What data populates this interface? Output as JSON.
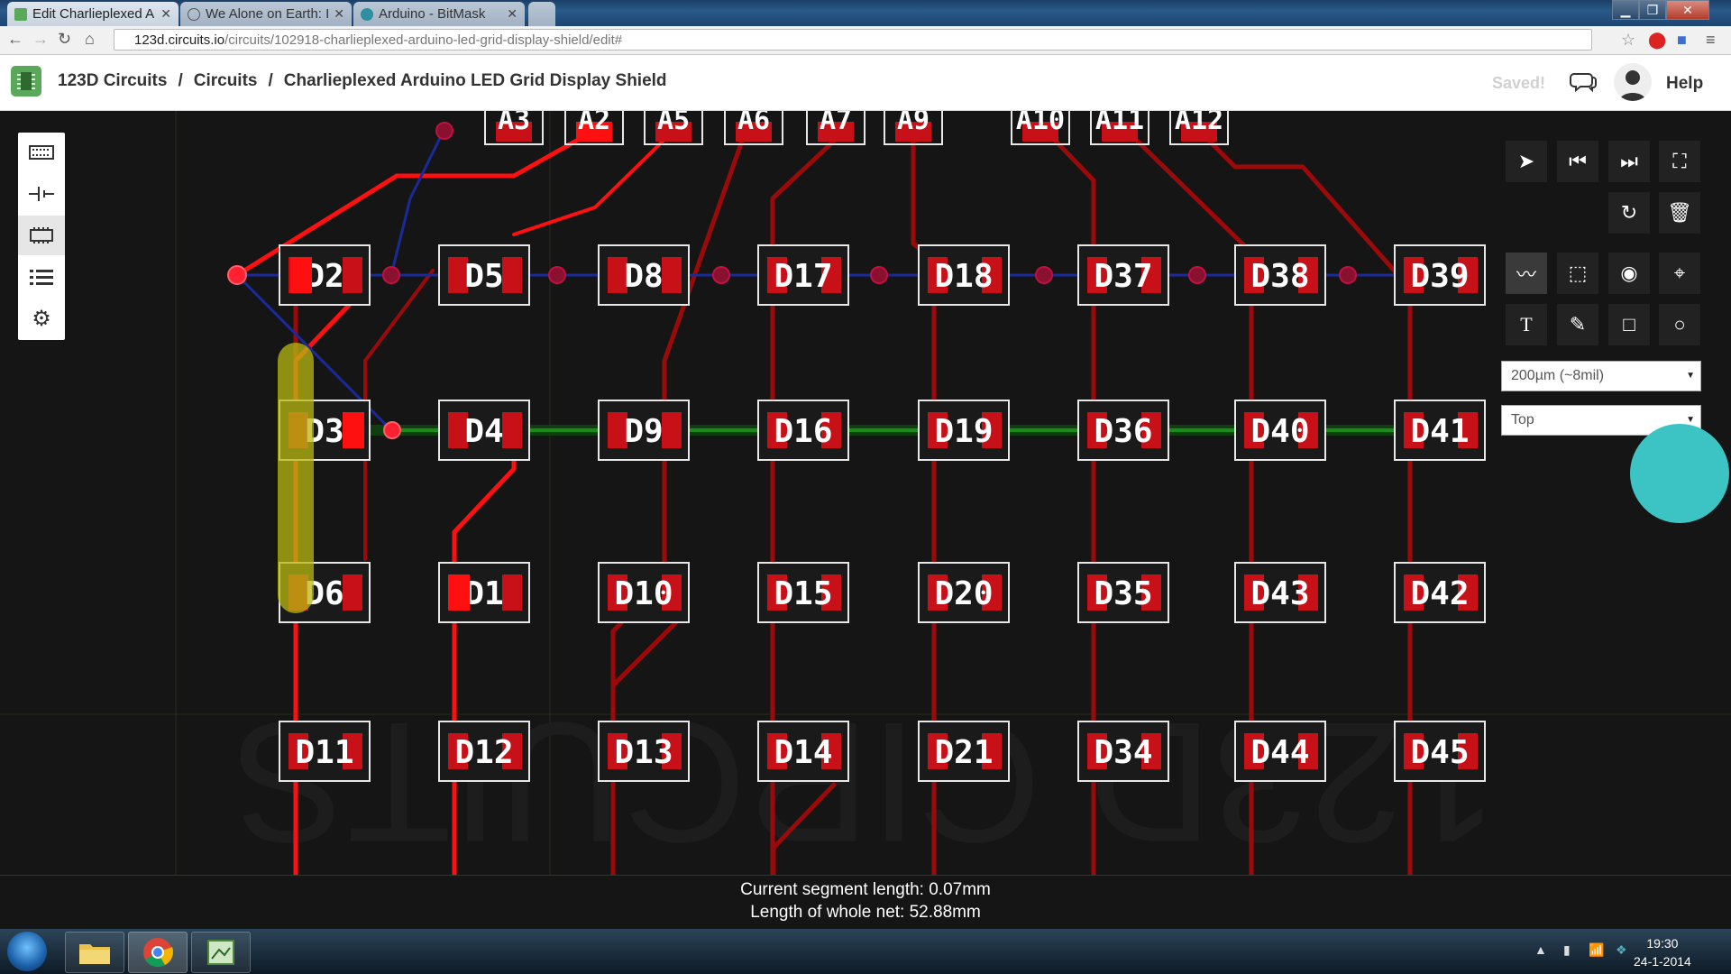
{
  "browser": {
    "tabs": [
      {
        "title": "Edit Charlieplexed A",
        "active": true
      },
      {
        "title": "We Alone on Earth: I",
        "active": false
      },
      {
        "title": "Arduino - BitMask",
        "active": false
      }
    ],
    "url_host": "123d.circuits.io",
    "url_path": "/circuits/102918-charlieplexed-arduino-led-grid-display-shield/edit#"
  },
  "header": {
    "crumbs": [
      "123D Circuits",
      "Circuits",
      "Charlieplexed Arduino LED Grid Display Shield"
    ],
    "separator": "/",
    "status": "Saved!",
    "help": "Help"
  },
  "right_panel": {
    "trace_width": "200µm (~8mil)",
    "layer": "Top"
  },
  "pcb": {
    "header_pins": [
      "A3",
      "A2",
      "A5",
      "A6",
      "A7",
      "A9",
      "A10",
      "A11",
      "A12"
    ],
    "led_rows": [
      [
        "D2",
        "D5",
        "D8",
        "D17",
        "D18",
        "D37",
        "D38",
        "D39"
      ],
      [
        "D3",
        "D4",
        "D9",
        "D16",
        "D19",
        "D36",
        "D40",
        "D41"
      ],
      [
        "D6",
        "D1",
        "D10",
        "D15",
        "D20",
        "D35",
        "D43",
        "D42"
      ],
      [
        "D11",
        "D12",
        "D13",
        "D14",
        "D21",
        "D34",
        "D44",
        "D45"
      ]
    ],
    "watermark": "123D CIRCUITS"
  },
  "status": {
    "segment": "Current segment length: 0.07mm",
    "net": "Length of whole net: 52.88mm"
  },
  "taskbar": {
    "time": "19:30",
    "date": "24-1-2014"
  },
  "colors": {
    "trace_top": "#ff1010",
    "trace_dim": "#9a0a0a",
    "trace_bottom": "#1a2a9a",
    "net_highlight": "#1a8a1a",
    "selection": "#b8b810",
    "accent": "#3cc4c4"
  }
}
